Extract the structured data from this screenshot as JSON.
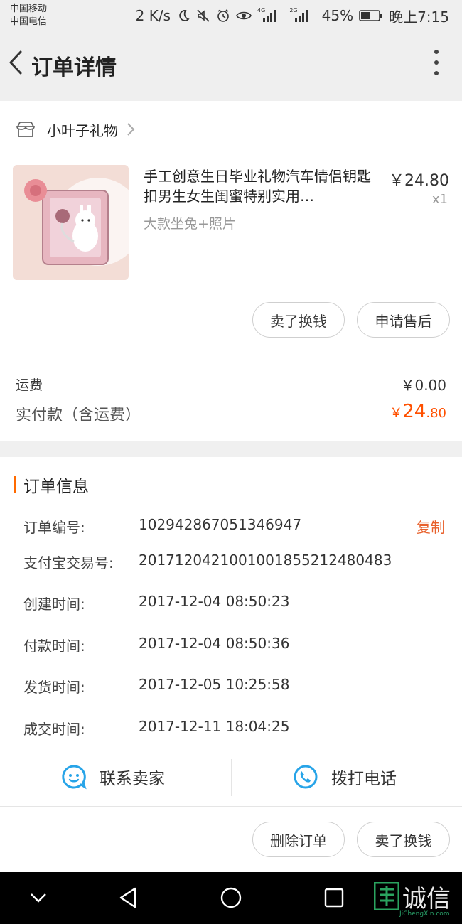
{
  "status_bar": {
    "carrier_1": "中国移动",
    "carrier_2": "中国电信",
    "net_speed": "2 K/s",
    "signal_1_type": "4G",
    "signal_2_type": "2G",
    "battery": "45%",
    "time": "晚上7:15"
  },
  "header": {
    "title": "订单详情"
  },
  "shop": {
    "name": "小叶子礼物"
  },
  "product": {
    "title": "手工创意生日毕业礼物汽车情侣钥匙扣男生女生闺蜜特别实用…",
    "price": "￥24.80",
    "quantity": "x1",
    "sku": "大款坐兔+照片"
  },
  "item_actions": {
    "sell_label": "卖了换钱",
    "after_sale_label": "申请售后"
  },
  "summary": {
    "shipping_label": "运费",
    "shipping_value": "￥0.00",
    "total_label": "实付款（含运费）",
    "total_currency": "￥",
    "total_int": "24",
    "total_dec": ".80"
  },
  "order_info": {
    "section_title": "订单信息",
    "copy_label": "复制",
    "rows": [
      {
        "label": "订单编号:",
        "value": "102942867051346947"
      },
      {
        "label": "支付宝交易号:",
        "value": "2017120421001001855212480483"
      },
      {
        "label": "创建时间:",
        "value": "2017-12-04 08:50:23"
      },
      {
        "label": "付款时间:",
        "value": "2017-12-04 08:50:36"
      },
      {
        "label": "发货时间:",
        "value": "2017-12-05 10:25:58"
      },
      {
        "label": "成交时间:",
        "value": "2017-12-11 18:04:25"
      }
    ]
  },
  "contact": {
    "seller_label": "联系卖家",
    "phone_label": "拨打电话"
  },
  "bottom_actions": {
    "delete_label": "删除订单",
    "sell_label": "卖了换钱"
  },
  "watermark": {
    "text": "诚信",
    "sub": "JiChengXin.com"
  },
  "colors": {
    "accent": "#ff5000",
    "copy": "#e8612c",
    "contact_icon": "#27a4e8"
  }
}
